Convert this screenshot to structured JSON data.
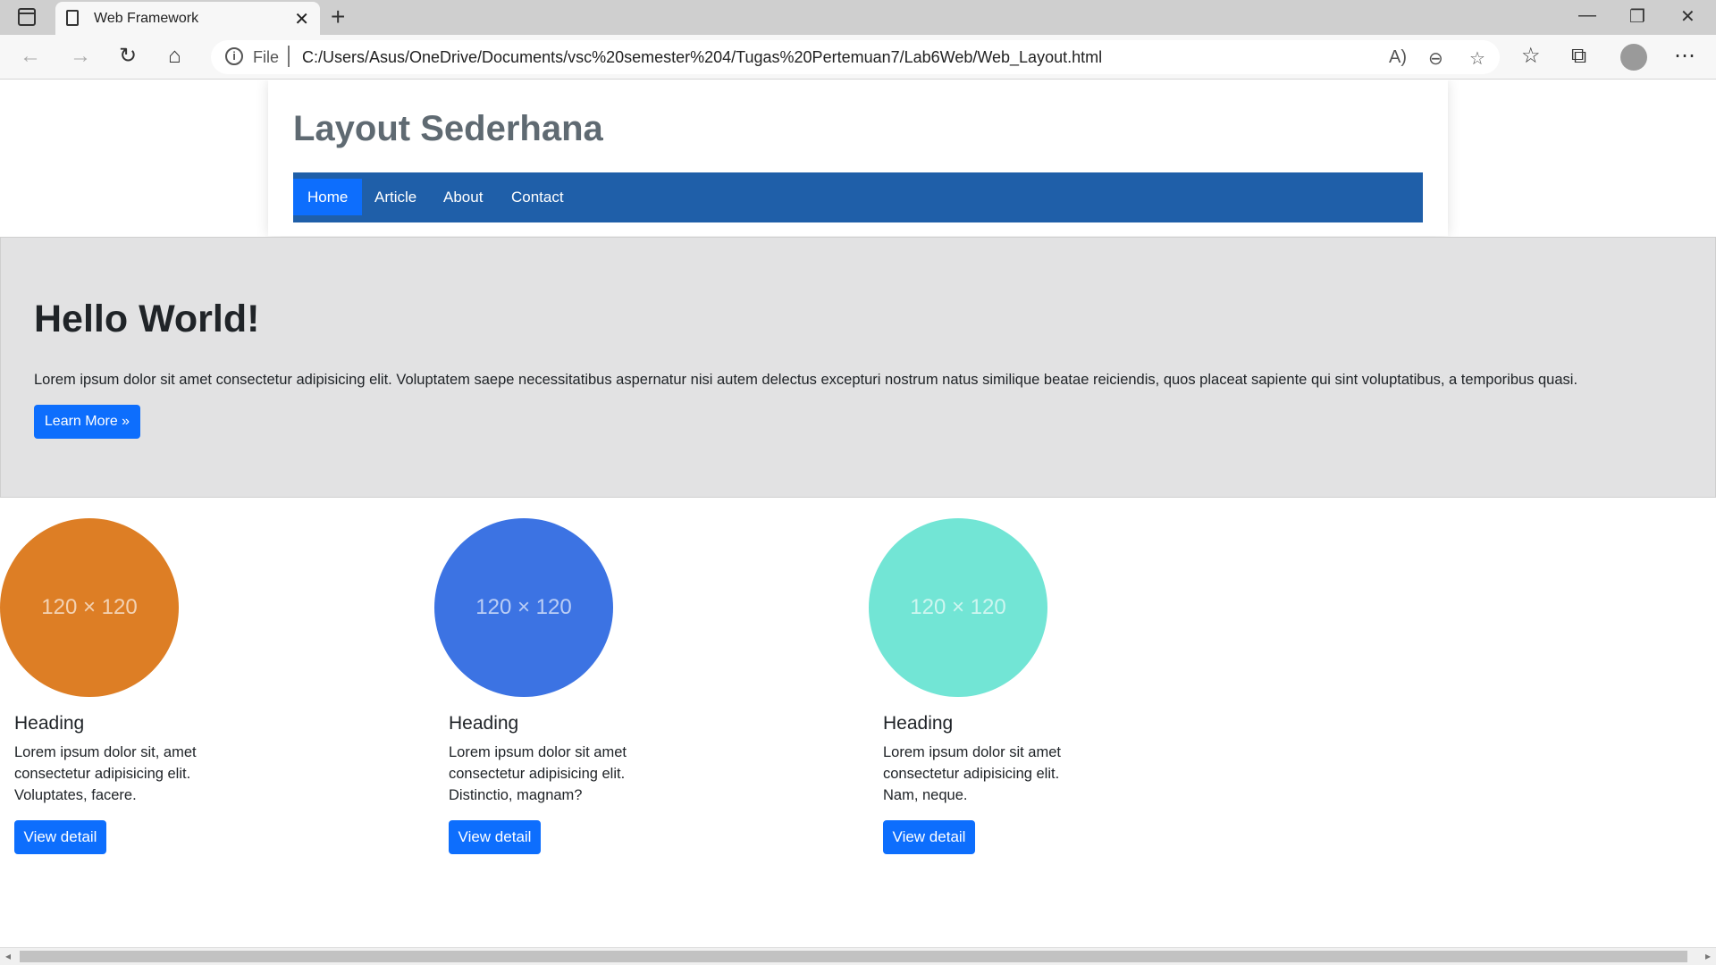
{
  "browser": {
    "tab_title": "Web Framework",
    "tab_close": "✕",
    "new_tab": "+",
    "window_controls": [
      "—",
      "❐",
      "✕"
    ],
    "nav_icons": [
      "back-icon",
      "forward-icon",
      "refresh-icon",
      "home-icon"
    ],
    "address": {
      "scheme_label": "File",
      "url": "C:/Users/Asus/OneDrive/Documents/vsc%20semester%204/Tugas%20Pertemuan7/Lab6Web/Web_Layout.html"
    },
    "toolbar_icons": [
      "read-aloud-icon",
      "zoom-out-icon",
      "add-favorite-icon",
      "favorites-icon",
      "collections-icon",
      "profile-icon",
      "more-icon"
    ]
  },
  "page": {
    "site_title": "Layout Sederhana",
    "nav": [
      {
        "label": "Home",
        "active": true
      },
      {
        "label": "Article",
        "active": false
      },
      {
        "label": "About",
        "active": false
      },
      {
        "label": "Contact",
        "active": false
      }
    ],
    "hero": {
      "title": "Hello World!",
      "text": "Lorem ipsum dolor sit amet consectetur adipisicing elit. Voluptatem saepe necessitatibus aspernatur nisi autem delectus excepturi nostrum natus similique beatae reiciendis, quos placeat sapiente qui sint voluptatibus, a temporibus quasi.",
      "button": "Learn More »"
    },
    "cards": [
      {
        "placeholder": "120 × 120",
        "color": "#dd7e25",
        "heading": "Heading",
        "text": "Lorem ipsum dolor sit, amet consectetur adipisicing elit. Voluptates, facere.",
        "button": "View detail"
      },
      {
        "placeholder": "120 × 120",
        "color": "#3c73e3",
        "heading": "Heading",
        "text": "Lorem ipsum dolor sit amet consectetur adipisicing elit. Distinctio, magnam?",
        "button": "View detail"
      },
      {
        "placeholder": "120 × 120",
        "color": "#72e5d5",
        "heading": "Heading",
        "text": "Lorem ipsum dolor sit amet consectetur adipisicing elit. Nam, neque.",
        "button": "View detail"
      }
    ]
  },
  "colors": {
    "nav_bg": "#1f5fa9",
    "primary": "#0d6efd",
    "hero_bg": "#e2e2e3"
  }
}
